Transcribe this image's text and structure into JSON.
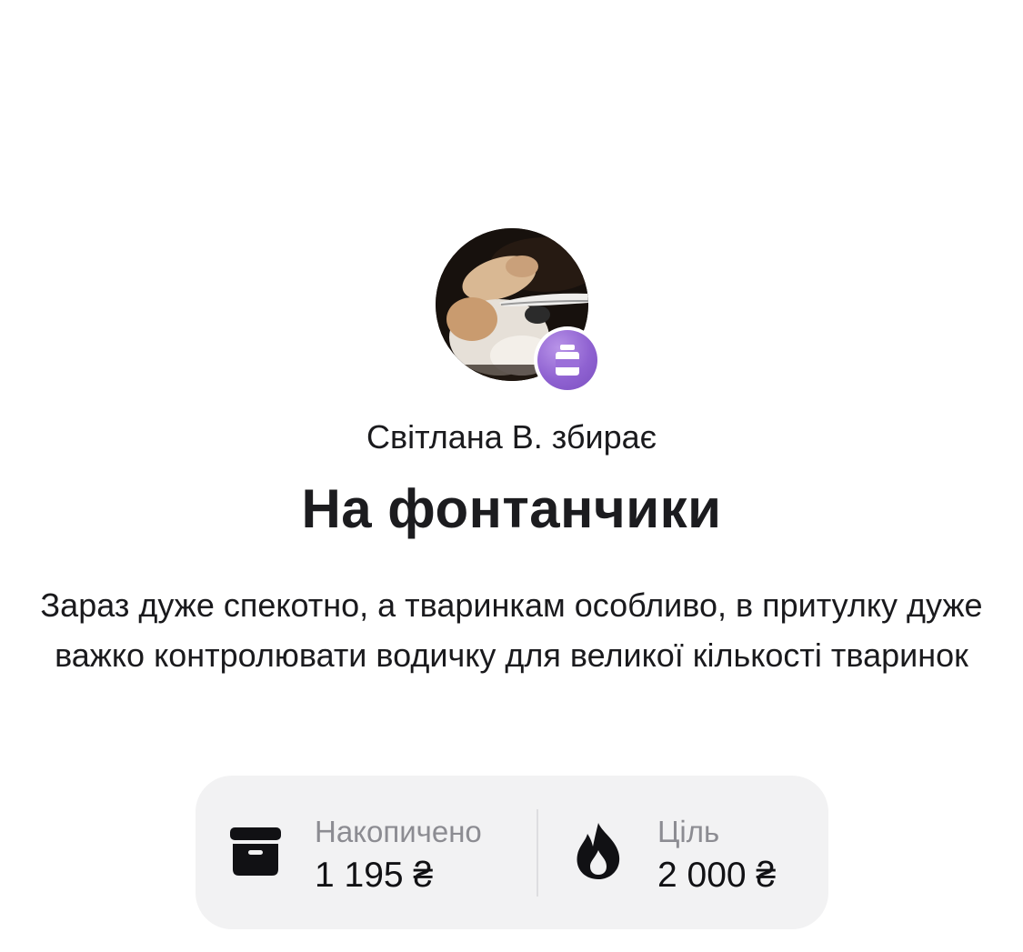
{
  "jar": {
    "owner_line": "Світлана В. збирає",
    "title": "На фонтанчики",
    "description": "Зараз дуже спекотно, а тваринкам особливо, в притулку дуже важко контролювати водичку для великої кількості тваринок",
    "badge_icon": "jar-icon",
    "badge_color": "#8f62d1"
  },
  "stats": {
    "collected": {
      "icon": "box-icon",
      "label": "Накопичено",
      "value": "1 195 ₴"
    },
    "goal": {
      "icon": "flame-icon",
      "label": "Ціль",
      "value": "2 000 ₴"
    },
    "progress_fraction": 0.5975
  }
}
